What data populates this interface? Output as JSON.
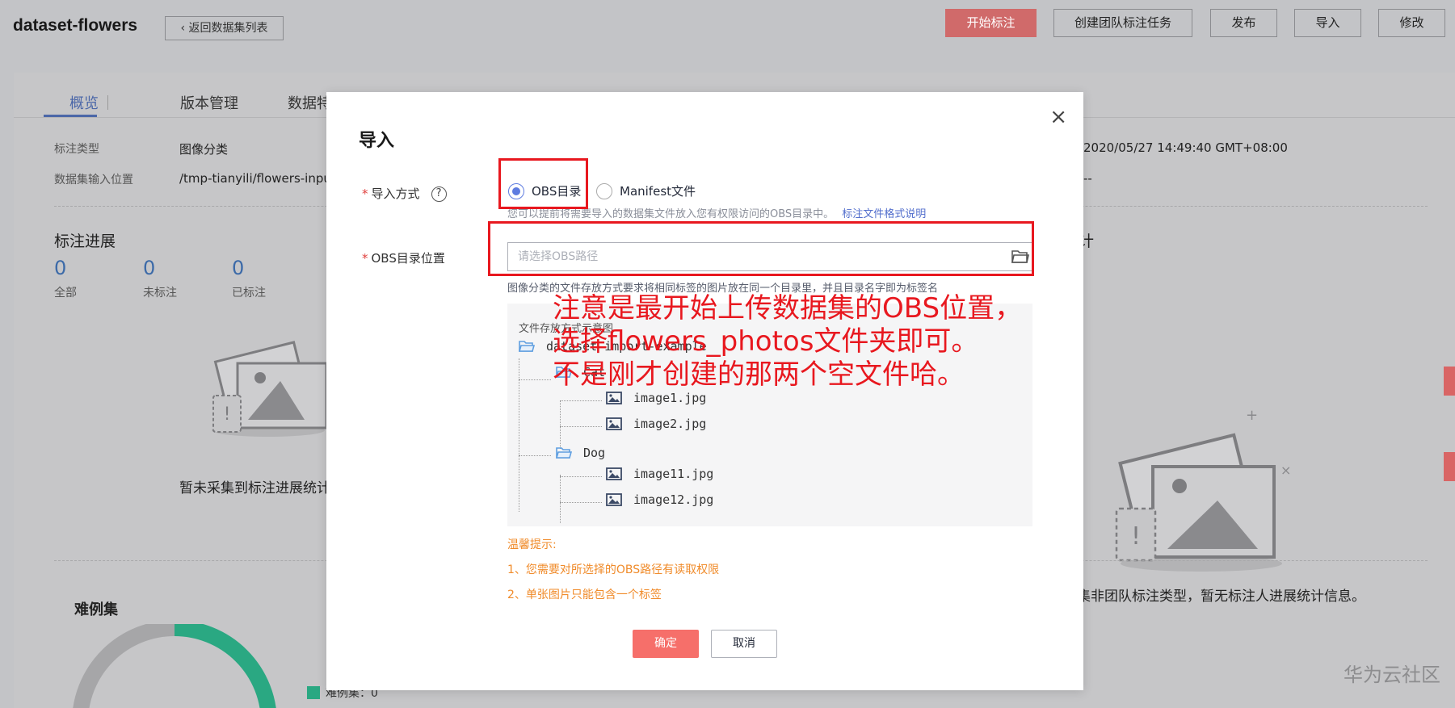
{
  "header": {
    "dataset_name": "dataset-flowers",
    "back_label": "返回数据集列表",
    "buttons": {
      "start_label": "开始标注",
      "team_task_label": "创建团队标注任务",
      "publish_label": "发布",
      "import_label": "导入",
      "edit_label": "修改"
    }
  },
  "tabs": [
    {
      "label": "概览"
    },
    {
      "label": "版本管理"
    },
    {
      "label": "数据特征"
    }
  ],
  "meta": {
    "label_type_label": "标注类型",
    "label_type_value": "图像分类",
    "input_loc_label": "数据集输入位置",
    "input_loc_value": "/tmp-tianyili/flowers-inpu",
    "created_time": "2020/05/27 14:49:40 GMT+08:00",
    "dashes": "--"
  },
  "progress": {
    "title": "标注进展",
    "stats": [
      {
        "value": "0",
        "label": "全部"
      },
      {
        "value": "0",
        "label": "未标注"
      },
      {
        "value": "0",
        "label": "已标注"
      }
    ],
    "empty_text": "暂未采集到标注进展统计"
  },
  "team": {
    "title_tail": "计",
    "empty_text": "集非团队标注类型，暂无标注人进展统计信息。"
  },
  "hard": {
    "title": "难例集",
    "legend": "难例集：0"
  },
  "watermark": "华为云社区",
  "modal": {
    "title": "导入",
    "import_method_label": "导入方式",
    "help_glyph": "?",
    "radio_obs_label": "OBS目录",
    "radio_manifest_label": "Manifest文件",
    "hint_text": "您可以提前将需要导入的数据集文件放入您有权限访问的OBS目录中。",
    "hint_link": "标注文件格式说明",
    "obs_loc_label": "OBS目录位置",
    "obs_placeholder": "请选择OBS路径",
    "obs_value": "",
    "obs_rule": "图像分类的文件存放方式要求将相同标签的图片放在同一个目录里，并且目录名字即为标签名",
    "example_title": "文件存放方式示意图",
    "tree": {
      "root": "dataset-import-example",
      "cat_folder": "Cat",
      "cat_files": [
        "image1.jpg",
        "image2.jpg"
      ],
      "dog_folder": "Dog",
      "dog_files": [
        "image11.jpg",
        "image12.jpg"
      ]
    },
    "tips_title": "温馨提示:",
    "tips": [
      "1、您需要对所选择的OBS路径有读取权限",
      "2、单张图片只能包含一个标签"
    ],
    "ok_label": "确定",
    "cancel_label": "取消",
    "close_glyph": "×"
  },
  "annotation": {
    "lines": [
      "注意是最开始上传数据集的OBS位置，",
      "选择flowers_photos文件夹即可。",
      "不是刚才创建的那两个空文件哈。"
    ]
  },
  "colors": {
    "accent": "#5e7ce0",
    "primary_red": "#f66f6a",
    "annotation_red": "#e8181f",
    "tip_orange": "#f08b2a"
  }
}
